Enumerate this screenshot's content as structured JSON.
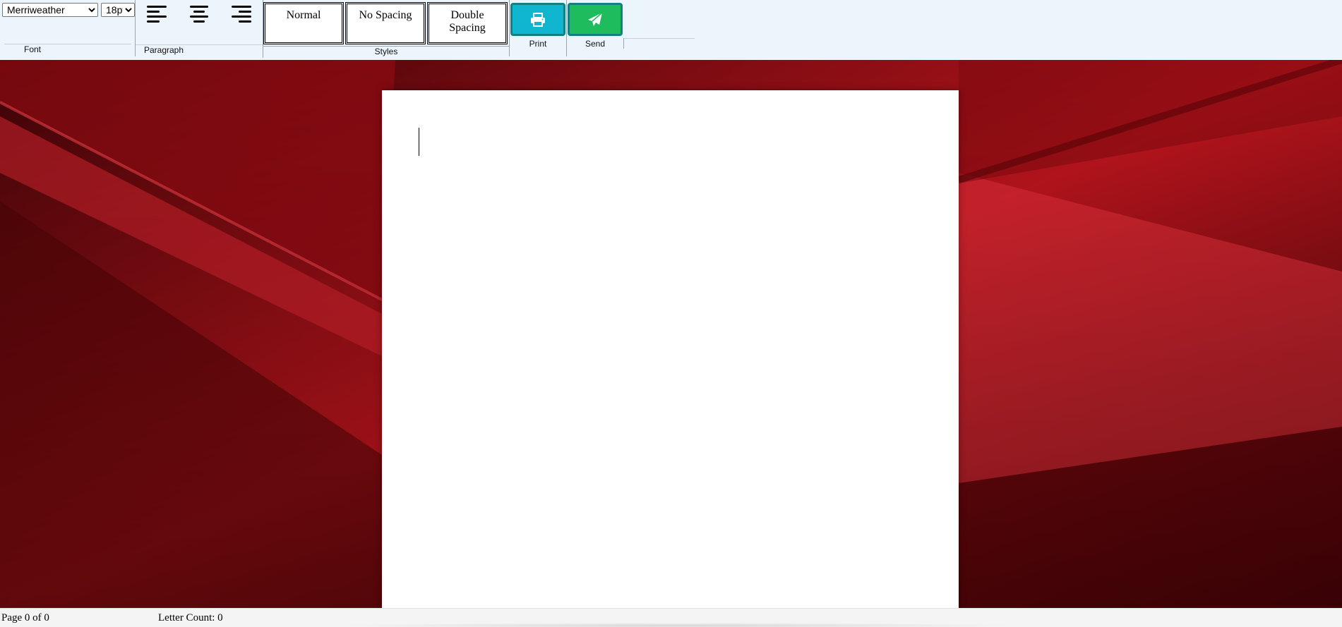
{
  "ribbon": {
    "font": {
      "family_value": "Merriweather",
      "family_options": [
        "Merriweather"
      ],
      "size_value": "18pt",
      "size_options": [
        "18pt"
      ],
      "group_label": "Font"
    },
    "paragraph": {
      "group_label": "Paragraph",
      "buttons": [
        "align-left-icon",
        "align-center-icon",
        "align-right-icon"
      ]
    },
    "styles": {
      "group_label": "Styles",
      "normal_label": "Normal",
      "no_spacing_label": "No Spacing",
      "double_spacing_label": "Double Spacing"
    },
    "print": {
      "label": "Print",
      "icon": "printer-icon",
      "color": "#10b5d0"
    },
    "send": {
      "label": "Send",
      "icon": "paper-plane-icon",
      "color": "#1ebc5c"
    }
  },
  "document": {
    "content": ""
  },
  "status": {
    "page": "Page 0 of 0",
    "letter_count": "Letter Count: 0"
  },
  "colors": {
    "ribbon_bg": "#ecf5fc",
    "button_border": "#128081",
    "background_red": "#c3161f"
  }
}
